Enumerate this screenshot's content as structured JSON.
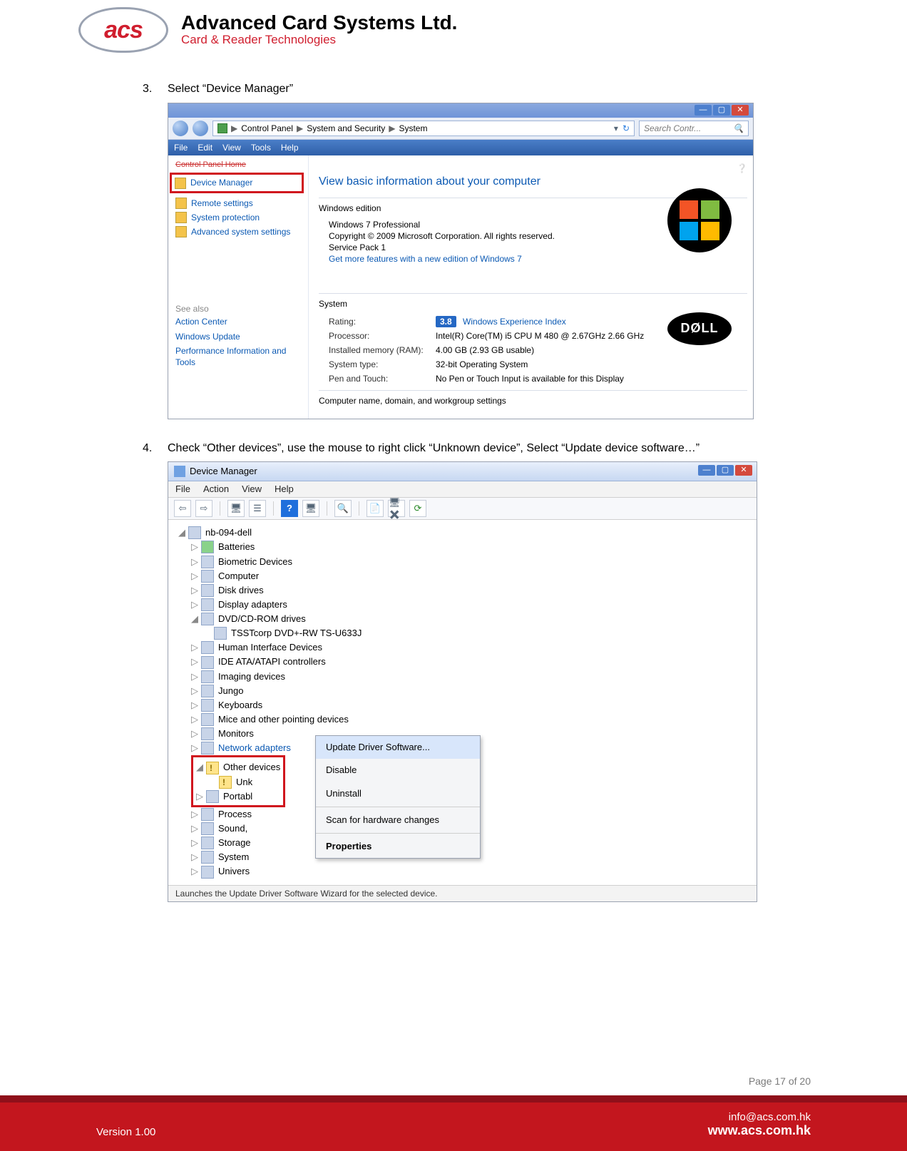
{
  "header": {
    "logo_text": "acs",
    "company_name": "Advanced Card Systems Ltd.",
    "company_tagline": "Card & Reader Technologies"
  },
  "step3": {
    "text": "Select “Device Manager”",
    "win": {
      "breadcrumb": [
        "Control Panel",
        "System and Security",
        "System"
      ],
      "search_placeholder": "Search Contr...",
      "menu": [
        "File",
        "Edit",
        "View",
        "Tools",
        "Help"
      ],
      "left": {
        "home": "Control Panel Home",
        "device_manager": "Device Manager",
        "links": [
          "Remote settings",
          "System protection",
          "Advanced system settings"
        ],
        "see_also_label": "See also",
        "see_also": [
          "Action Center",
          "Windows Update",
          "Performance Information and Tools"
        ]
      },
      "right": {
        "title": "View basic information about your computer",
        "edition_label": "Windows edition",
        "edition": "Windows 7 Professional",
        "copyright": "Copyright © 2009 Microsoft Corporation. All rights reserved.",
        "sp": "Service Pack 1",
        "more": "Get more features with a new edition of Windows 7",
        "system_label": "System",
        "rating_label": "Rating:",
        "wei_score": "3.8",
        "wei_text": "Windows Experience Index",
        "processor_label": "Processor:",
        "processor": "Intel(R) Core(TM) i5 CPU        M 480  @ 2.67GHz  2.66 GHz",
        "ram_label": "Installed memory (RAM):",
        "ram": "4.00 GB (2.93 GB usable)",
        "type_label": "System type:",
        "type": "32-bit Operating System",
        "pen_label": "Pen and Touch:",
        "pen": "No Pen or Touch Input is available for this Display",
        "dom_label": "Computer name, domain, and workgroup settings",
        "dell": "DØLL"
      }
    }
  },
  "step4": {
    "text": "Check “Other devices”, use the mouse to right click “Unknown device”, Select “Update device software…”",
    "win": {
      "title": "Device Manager",
      "menu": [
        "File",
        "Action",
        "View",
        "Help"
      ],
      "root": "nb-094-dell",
      "nodes": [
        "Batteries",
        "Biometric Devices",
        "Computer",
        "Disk drives",
        "Display adapters",
        "DVD/CD-ROM drives",
        "TSSTcorp DVD+-RW TS-U633J",
        "Human Interface Devices",
        "IDE ATA/ATAPI controllers",
        "Imaging devices",
        "Jungo",
        "Keyboards",
        "Mice and other pointing devices",
        "Monitors",
        "Network adapters"
      ],
      "other_label": "Other devices",
      "unknown": "Unk",
      "after": [
        "Portabl",
        "Process",
        "Sound,",
        "Storage",
        "System",
        "Univers"
      ],
      "ctx": [
        "Update Driver Software...",
        "Disable",
        "Uninstall",
        "Scan for hardware changes",
        "Properties"
      ],
      "status": "Launches the Update Driver Software Wizard for the selected device."
    }
  },
  "footer": {
    "page": "Page 17 of 20",
    "version": "Version 1.00",
    "email": "info@acs.com.hk",
    "site": "www.acs.com.hk"
  }
}
